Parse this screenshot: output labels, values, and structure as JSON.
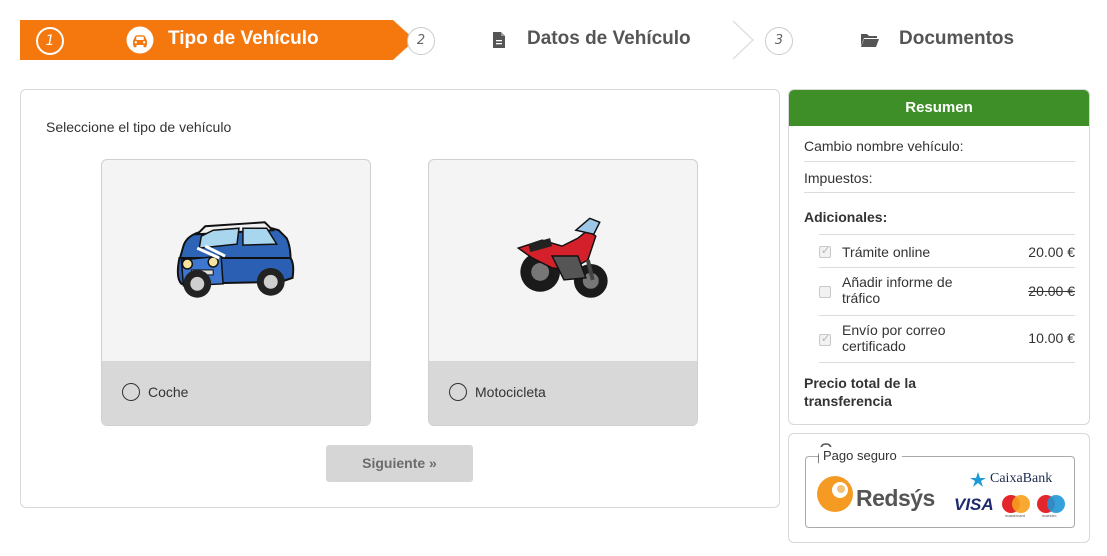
{
  "stepper": {
    "steps": [
      {
        "number": "1",
        "label": "Tipo de Vehículo",
        "icon": "car-icon",
        "active": true
      },
      {
        "number": "2",
        "label": "Datos de Vehículo",
        "icon": "file-icon",
        "active": false
      },
      {
        "number": "3",
        "label": "Documentos",
        "icon": "folder-icon",
        "active": false
      }
    ],
    "active_color": "#f5780f"
  },
  "main": {
    "title": "Seleccione el tipo de vehículo",
    "options": [
      {
        "label": "Coche",
        "icon": "car-image",
        "selected": false
      },
      {
        "label": "Motocicleta",
        "icon": "motorcycle-image",
        "selected": false
      }
    ],
    "next_button": "Siguiente »"
  },
  "summary": {
    "header": "Resumen",
    "header_color": "#3f8f28",
    "rows": [
      "Cambio nombre vehículo:",
      "Impuestos:"
    ],
    "addons_title": "Adicionales:",
    "addons": [
      {
        "label": "Trámite online",
        "price": "20.00 €",
        "checked": true,
        "struck": false
      },
      {
        "label": "Añadir informe de tráfico",
        "price": "20.00 €",
        "checked": false,
        "struck": true
      },
      {
        "label": "Envío por correo certificado",
        "price": "10.00 €",
        "checked": true,
        "struck": false
      }
    ],
    "total_label": "Precio total de la transferencia"
  },
  "payment": {
    "legend": "Pago seguro",
    "redsys": "Redsýs",
    "caixabank": "CaixaBank",
    "visa": "VISA",
    "mastercard": "mastercard",
    "maestro": "maestro"
  }
}
